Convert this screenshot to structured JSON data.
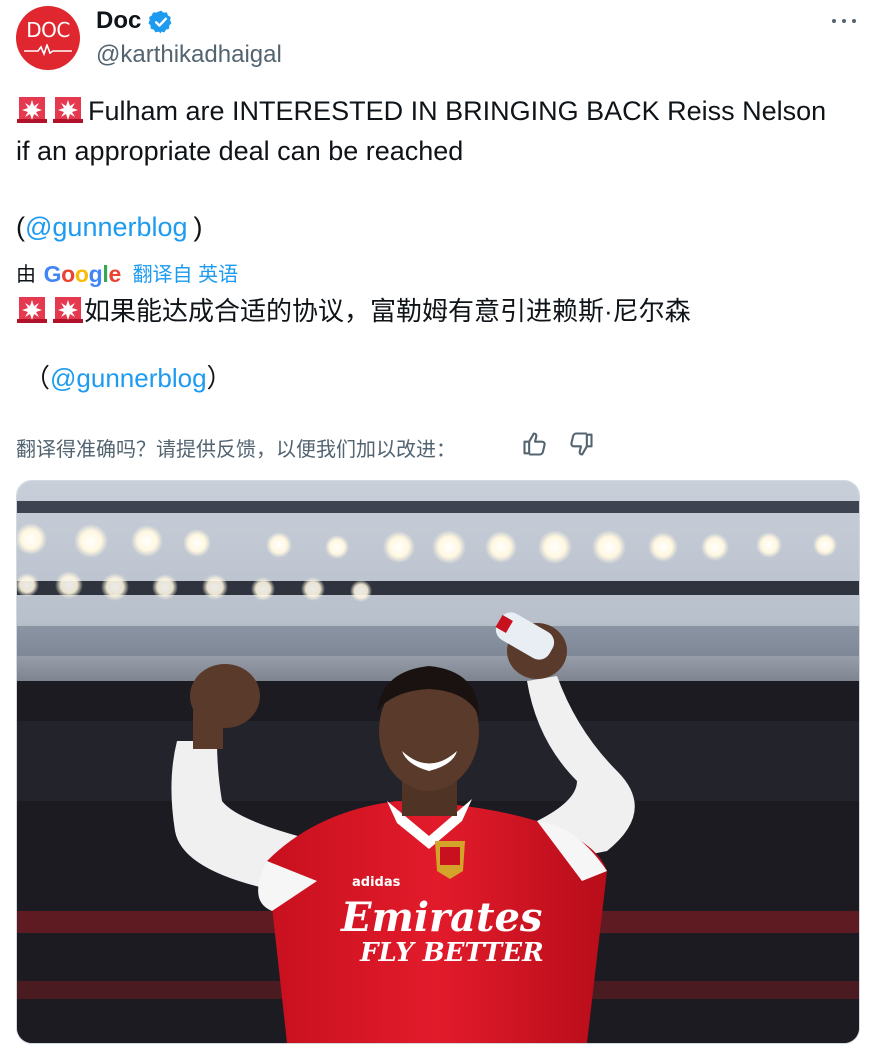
{
  "author": {
    "avatar_text": "DOC",
    "display_name": "Doc",
    "handle": "@karthikadhaigal",
    "verified": true
  },
  "tweet": {
    "emoji": "rotating-light-emoji",
    "line1": "Fulham are INTERESTED IN BRINGING BACK Reiss Nelson",
    "line2": "if an appropriate deal can be reached",
    "mention_open": "(",
    "mention": "@gunnerblog",
    "mention_close": ")"
  },
  "translation": {
    "by": "由",
    "provider": [
      "G",
      "o",
      "o",
      "g",
      "l",
      "e"
    ],
    "translated_from": "翻译自 英语",
    "line1": "如果能达成合适的协议，富勒姆有意引进赖斯·尼尔森",
    "mention_open": "（",
    "mention": "@gunnerblog",
    "mention_close": "）",
    "feedback_prompt": "翻译得准确吗？请提供反馈，以便我们加以改进："
  },
  "media": {
    "subject": "football player in red jersey celebrating",
    "jersey_text_1": "Emirates",
    "jersey_text_2": "FLY BETTER"
  },
  "colors": {
    "link": "#1d9bf0",
    "secondary_text": "#536471",
    "verified_badge": "#1d9bf0",
    "avatar_bg": "#e0262f"
  }
}
